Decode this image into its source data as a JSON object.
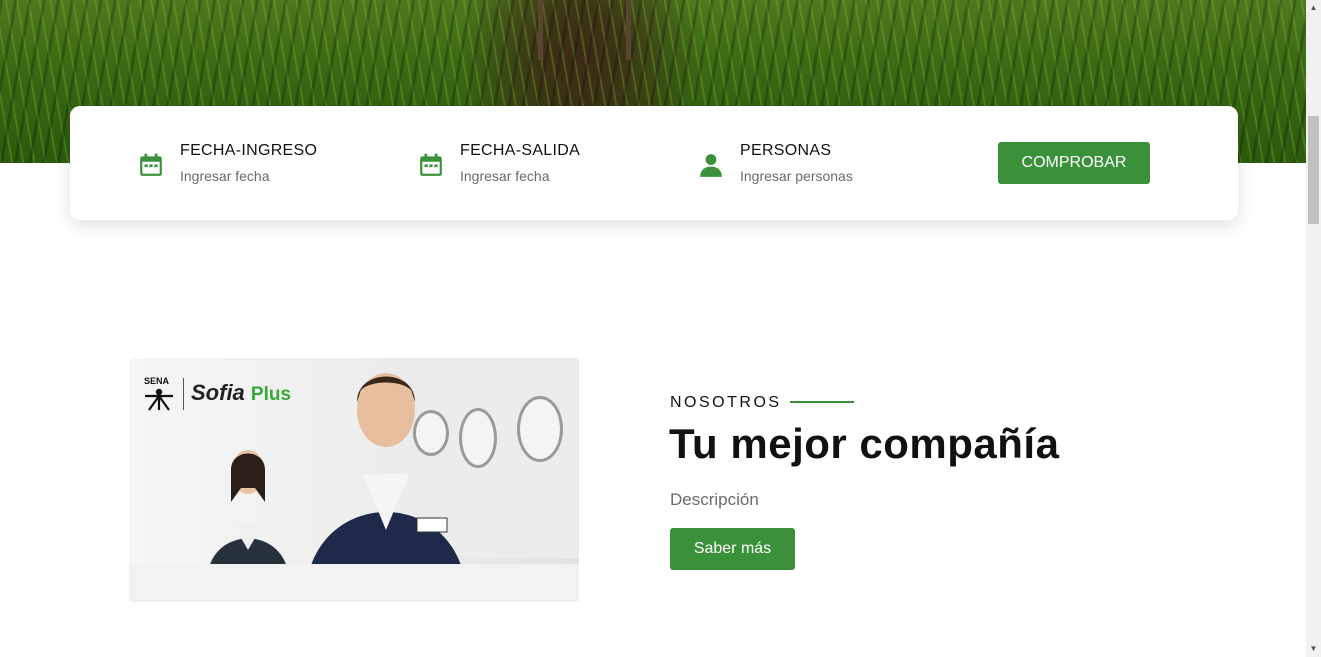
{
  "booking": {
    "check_in": {
      "label": "FECHA-INGRESO",
      "placeholder": "Ingresar fecha",
      "icon": "calendar-icon"
    },
    "check_out": {
      "label": "FECHA-SALIDA",
      "placeholder": "Ingresar fecha",
      "icon": "calendar-icon"
    },
    "guests": {
      "label": "PERSONAS",
      "placeholder": "Ingresar personas",
      "icon": "person-icon"
    },
    "submit_label": "COMPROBAR"
  },
  "about": {
    "kicker": "NOSOTROS",
    "title": "Tu mejor compañía",
    "description": "Descripción",
    "button_label": "Saber más"
  },
  "photo": {
    "logo_sena": "SENA",
    "logo_sofia": "Sofia",
    "logo_plus": "Plus"
  },
  "colors": {
    "accent_green": "#3a913a",
    "text_dark": "#111111",
    "text_muted": "#6b6b6b"
  }
}
